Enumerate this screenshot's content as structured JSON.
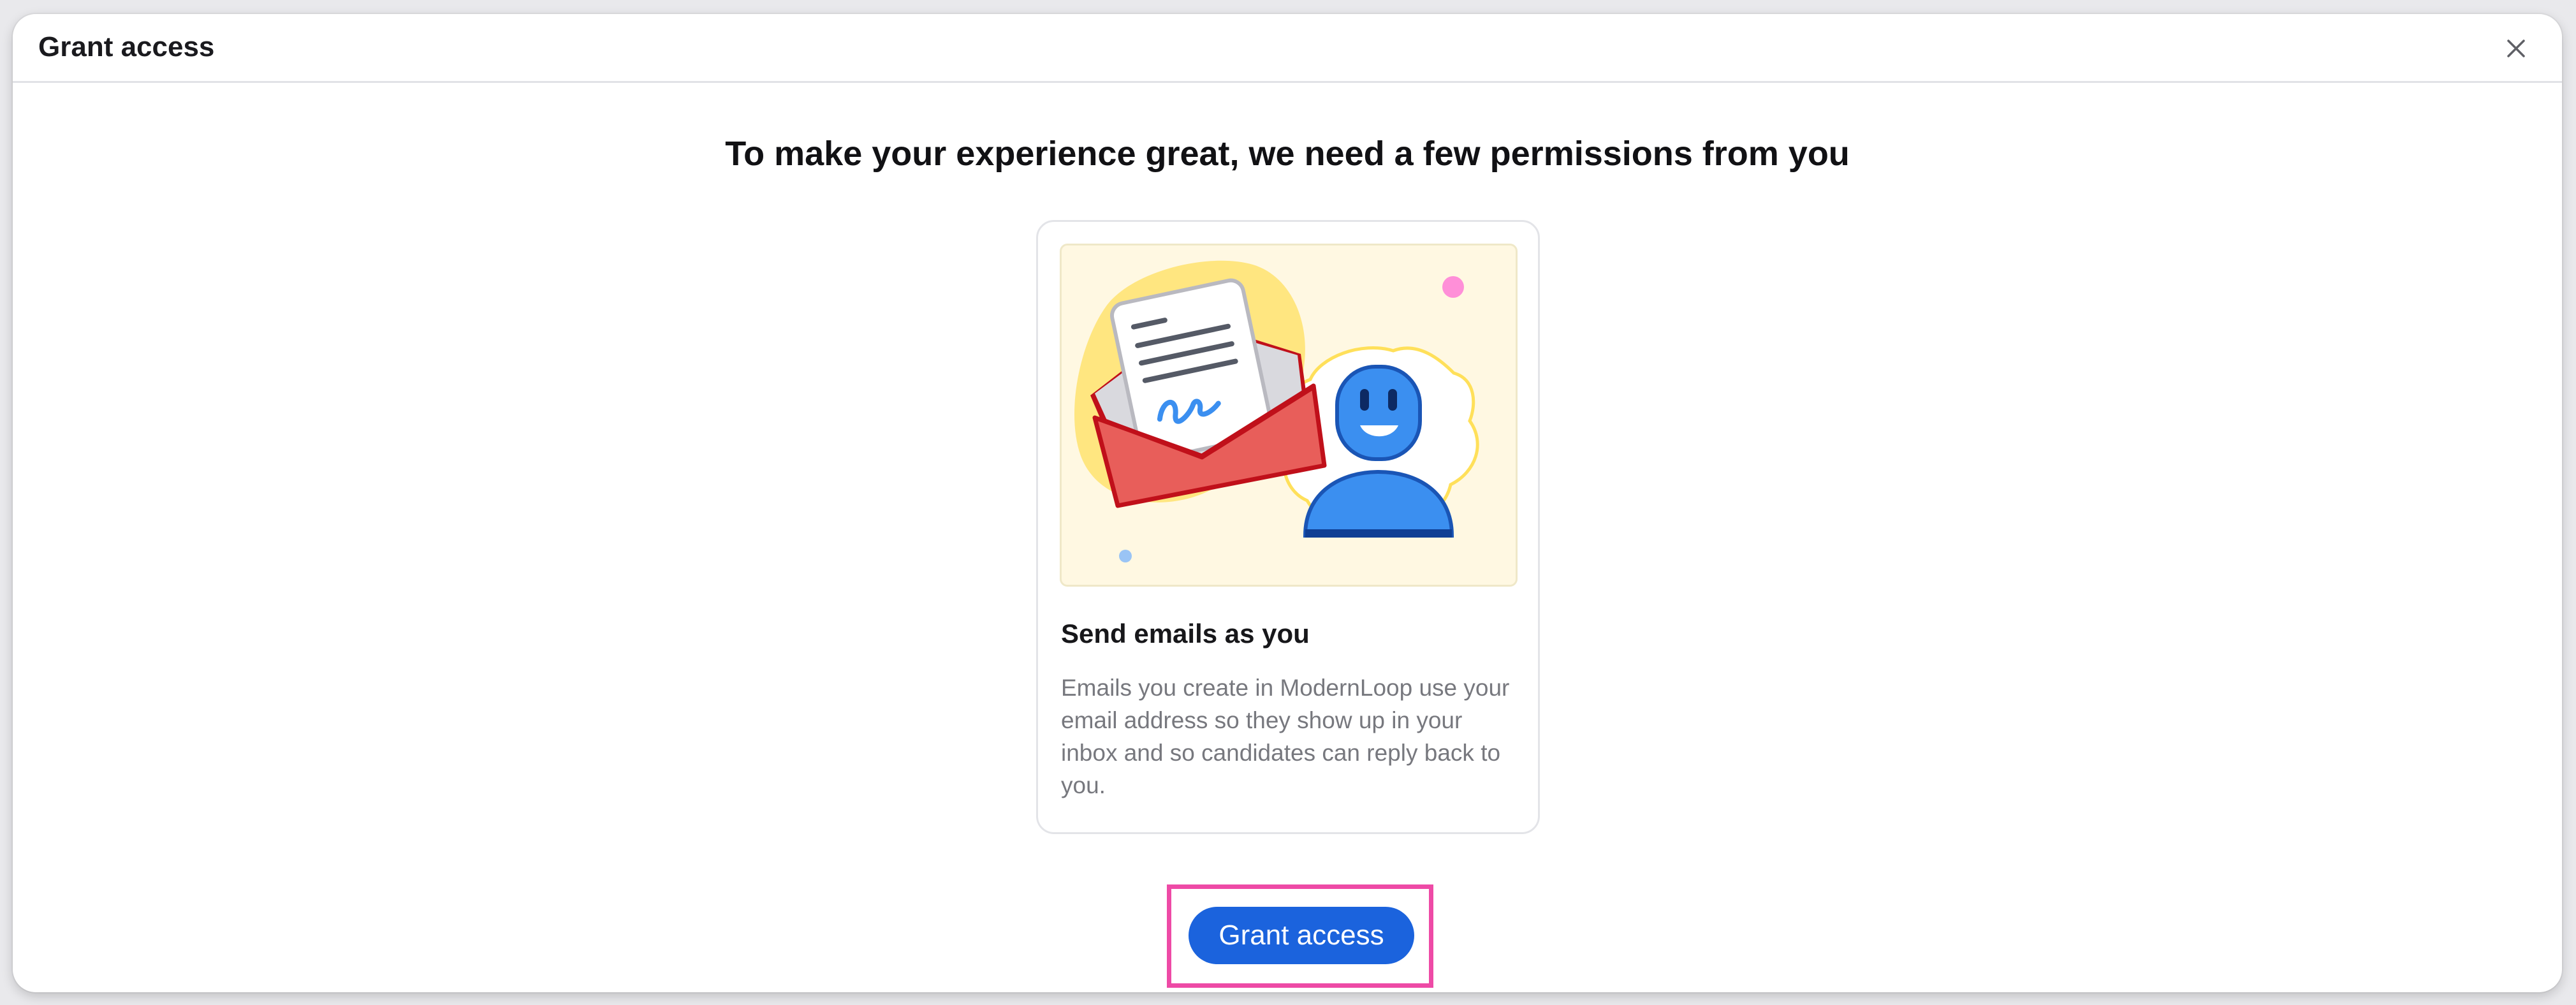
{
  "dialog": {
    "title": "Grant access",
    "close_icon": "close-icon"
  },
  "main": {
    "headline": "To make your experience great, we need a few permissions from you"
  },
  "permission_card": {
    "illustration_icon": "email-envelope-with-person-illustration",
    "title": "Send emails as you",
    "description": "Emails you create in ModernLoop use your email address so they show up in your inbox and so candidates can reply back to you."
  },
  "actions": {
    "grant_label": "Grant access"
  },
  "colors": {
    "primary": "#1b63dd",
    "highlight": "#ee4aa6",
    "illustration_bg": "#fff8e2",
    "envelope_red": "#e85e5a",
    "person_blue": "#3b8ff0"
  }
}
